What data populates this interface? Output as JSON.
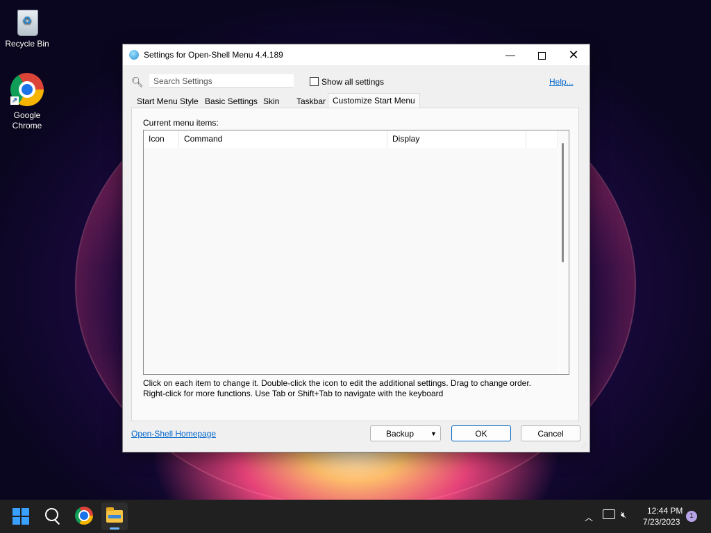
{
  "desktop": {
    "icons": [
      {
        "label": "Recycle Bin"
      },
      {
        "label": "Google Chrome"
      }
    ]
  },
  "window": {
    "title": "Settings for Open-Shell Menu 4.4.189",
    "controls": {
      "minimize": "—",
      "close": "✕"
    },
    "search": {
      "placeholder": "Search Settings",
      "value": ""
    },
    "show_all": {
      "label": "Show all settings",
      "checked": false
    },
    "help_label": "Help...",
    "tabs": [
      {
        "label": "Start Menu Style"
      },
      {
        "label": "Basic Settings"
      },
      {
        "label": "Skin"
      },
      {
        "label": "Taskbar"
      },
      {
        "label": "Customize Start Menu",
        "active": true
      }
    ],
    "list": {
      "label": "Current menu items:",
      "columns": [
        "Icon",
        "Command",
        "Display"
      ],
      "rows": []
    },
    "hint_line1": "Click on each item to change it. Double-click the icon to edit the additional settings. Drag to change order.",
    "hint_line2": "Right-click for more functions. Use Tab or Shift+Tab to navigate with the keyboard",
    "homepage_label": "Open-Shell Homepage",
    "buttons": {
      "backup": "Backup",
      "ok": "OK",
      "cancel": "Cancel"
    }
  },
  "taskbar": {
    "apps": [
      "start",
      "search",
      "google-chrome",
      "file-explorer"
    ],
    "tray": {
      "time": "12:44 PM",
      "date": "7/23/2023",
      "notification_count": "1"
    }
  },
  "colors": {
    "link": "#0066cc",
    "accent": "#0067c0",
    "taskbar": "#202020"
  }
}
